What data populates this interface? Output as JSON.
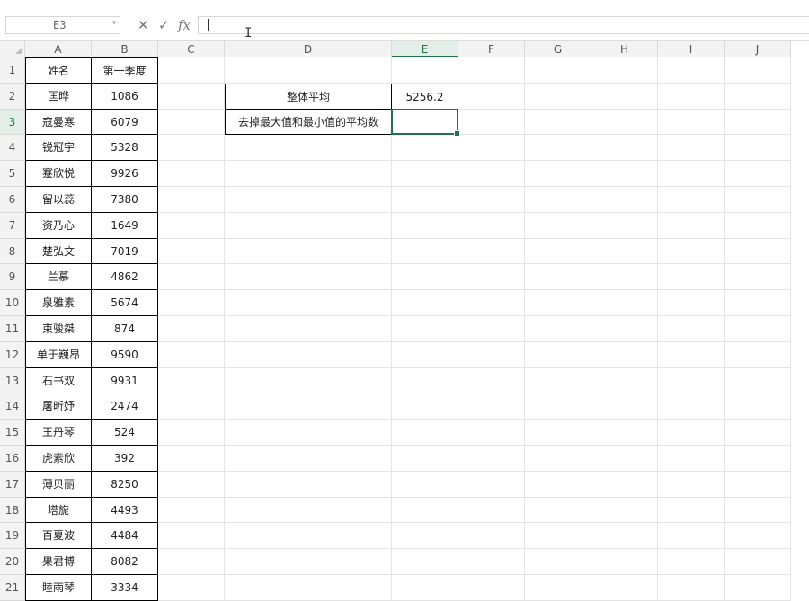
{
  "name_box": "E3",
  "formula_bar": {
    "cancel_glyph": "✕",
    "confirm_glyph": "✓",
    "fx_label": "fx",
    "content": ""
  },
  "columns": [
    "A",
    "B",
    "C",
    "D",
    "E",
    "F",
    "G",
    "H",
    "I",
    "J"
  ],
  "active_column": "E",
  "active_row": 3,
  "rows": [
    "1",
    "2",
    "3",
    "4",
    "5",
    "6",
    "7",
    "8",
    "9",
    "10",
    "11",
    "12",
    "13",
    "14",
    "15",
    "16",
    "17",
    "18",
    "19",
    "20",
    "21"
  ],
  "table": {
    "header_name": "姓名",
    "header_q1": "第一季度",
    "records": [
      {
        "name": "匡晔",
        "value": "1086"
      },
      {
        "name": "寇曼寒",
        "value": "6079"
      },
      {
        "name": "锐冠宇",
        "value": "5328"
      },
      {
        "name": "蹇欣悦",
        "value": "9926"
      },
      {
        "name": "留以蕊",
        "value": "7380"
      },
      {
        "name": "资乃心",
        "value": "1649"
      },
      {
        "name": "楚弘文",
        "value": "7019"
      },
      {
        "name": "兰慕",
        "value": "4862"
      },
      {
        "name": "泉雅素",
        "value": "5674"
      },
      {
        "name": "束骏桀",
        "value": "874"
      },
      {
        "name": "单于巍昂",
        "value": "9590"
      },
      {
        "name": "石书双",
        "value": "9931"
      },
      {
        "name": "屠昕妤",
        "value": "2474"
      },
      {
        "name": "王丹琴",
        "value": "524"
      },
      {
        "name": "虎素欣",
        "value": "392"
      },
      {
        "name": "薄贝丽",
        "value": "8250"
      },
      {
        "name": "塔旎",
        "value": "4493"
      },
      {
        "name": "百夏波",
        "value": "4484"
      },
      {
        "name": "果君博",
        "value": "8082"
      },
      {
        "name": "睦雨琴",
        "value": "3334"
      }
    ]
  },
  "summary": {
    "overall_avg_label": "整体平均",
    "overall_avg_value": "5256.2",
    "trimmed_avg_label": "去掉最大值和最小值的平均数",
    "trimmed_avg_value": ""
  },
  "colors": {
    "accent": "#217346",
    "header_bg": "#f3f3f3",
    "gridline": "#e4e4e4"
  }
}
